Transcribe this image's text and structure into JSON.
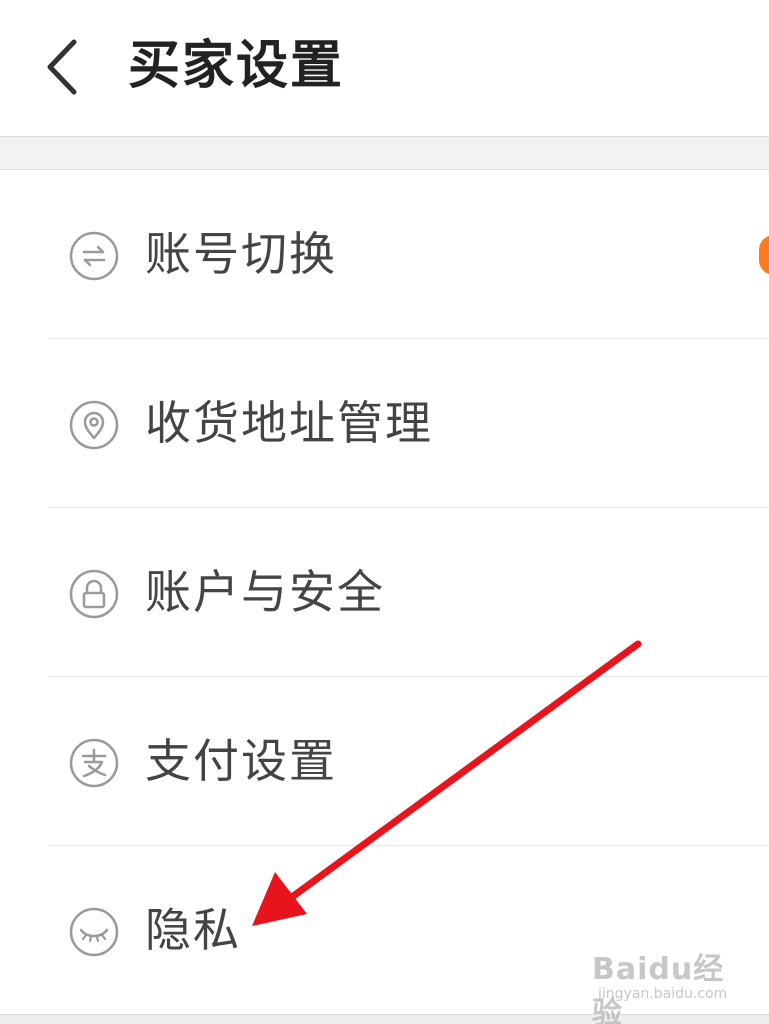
{
  "header": {
    "title": "买家设置",
    "back_icon": "chevron-left-icon"
  },
  "menu": {
    "items": [
      {
        "label": "账号切换",
        "icon": "switch-account-icon",
        "badge_color": "#ff7a1a"
      },
      {
        "label": "收货地址管理",
        "icon": "location-pin-icon"
      },
      {
        "label": "账户与安全",
        "icon": "lock-icon"
      },
      {
        "label": "支付设置",
        "icon": "payment-icon"
      },
      {
        "label": "隐私",
        "icon": "closed-eye-icon"
      }
    ]
  },
  "annotation": {
    "arrow_color": "#e8141c"
  },
  "watermark": {
    "main": "Baidu经验",
    "sub": "jingyan.baidu.com"
  }
}
